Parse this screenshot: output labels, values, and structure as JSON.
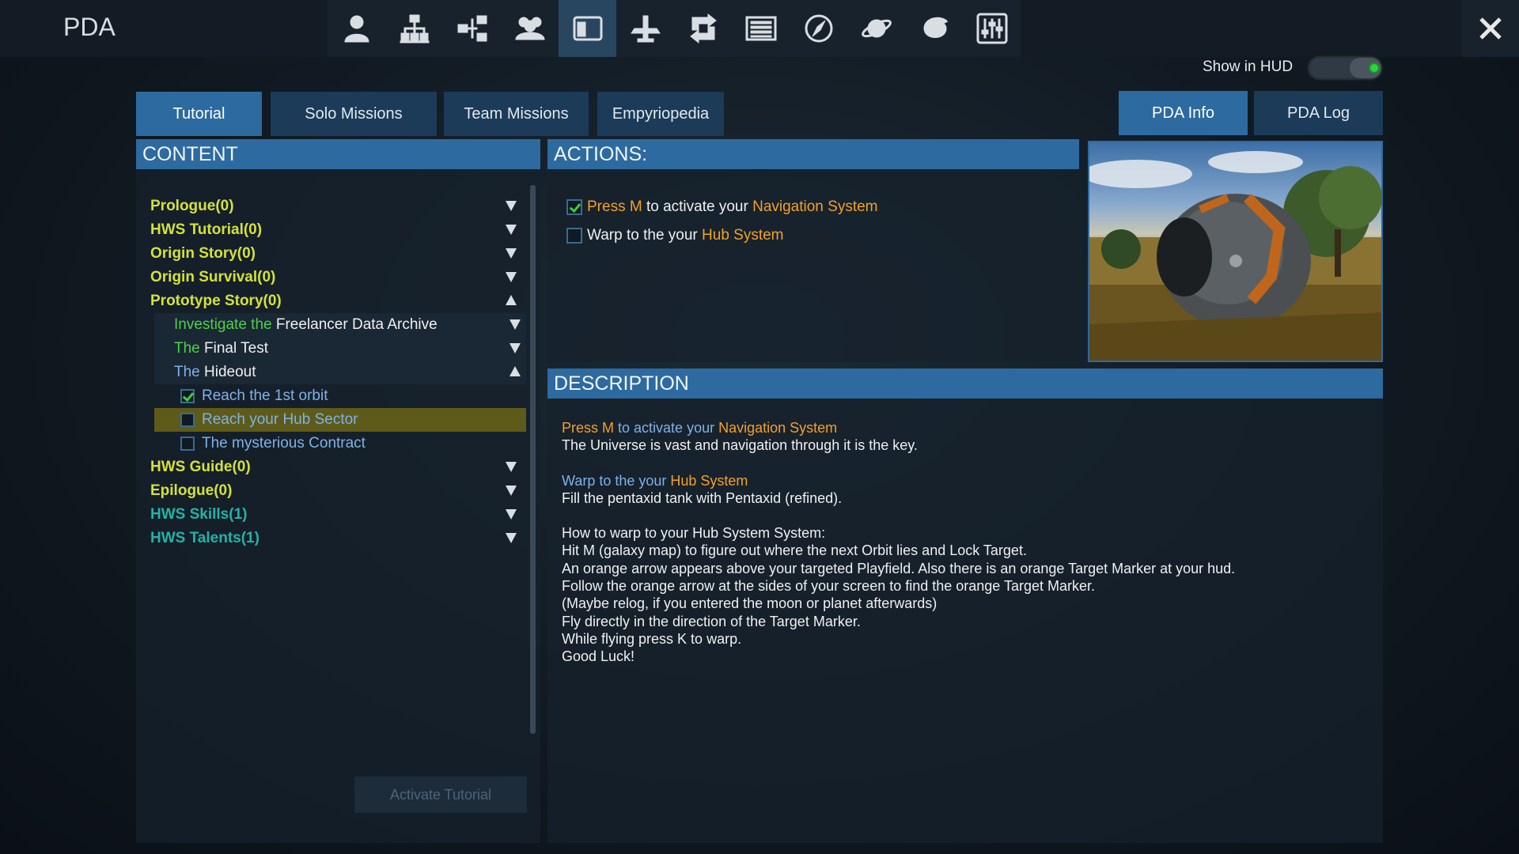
{
  "header": {
    "title": "PDA",
    "icons": [
      "player-icon",
      "network-icon",
      "structure-icon",
      "group-icon",
      "pda-window-icon",
      "ship-icon",
      "exchange-icon",
      "list-icon",
      "compass-icon",
      "planet-icon",
      "galaxy-icon",
      "settings-sliders-icon"
    ],
    "active_icon": 4
  },
  "hud": {
    "label": "Show in HUD",
    "enabled": true
  },
  "tabs": {
    "tutorial": "Tutorial",
    "solo": "Solo Missions",
    "team": "Team Missions",
    "empyriopedia": "Empyriopedia",
    "pda_info": "PDA Info",
    "pda_log": "PDA Log"
  },
  "content": {
    "header": "CONTENT",
    "items": {
      "prologue": "Prologue(0)",
      "hws_tutorial": "HWS Tutorial(0)",
      "origin_story": "Origin Story(0)",
      "origin_survival": "Origin Survival(0)",
      "prototype_story": "Prototype Story(0)",
      "investigate_pre": "Investigate the",
      "investigate_post": "Freelancer Data Archive",
      "final_pre": "The",
      "final_post": "Final Test",
      "hideout_pre": "The",
      "hideout_post": "Hideout",
      "task1": "Reach the 1st orbit",
      "task2": "Reach your Hub Sector",
      "task3": "The mysterious Contract",
      "hws_guide": "HWS Guide(0)",
      "epilogue": "Epilogue(0)",
      "hws_skills": "HWS Skills(1)",
      "hws_talents": "HWS Talents(1)"
    },
    "activate_button": "Activate Tutorial"
  },
  "actions": {
    "header": "ACTIONS:",
    "a1": {
      "p1": "Press M",
      "p2": " to activate your ",
      "p3": "Navigation System",
      "checked": true
    },
    "a2": {
      "p1": "Warp to the your ",
      "p2": "Hub System",
      "checked": false
    }
  },
  "description": {
    "header": "DESCRIPTION",
    "b1_p1": "Press M",
    "b1_p2": " to activate your ",
    "b1_p3": "Navigation System",
    "b1_line2": "The Universe is vast and navigation through it is the key.",
    "b2_p1": "Warp to the your ",
    "b2_p2": "Hub System",
    "b2_line2": "Fill the pentaxid tank with Pentaxid (refined).",
    "b3_lines": [
      "How to warp to your Hub System System:",
      "Hit M (galaxy map) to figure out where the next Orbit lies and Lock Target.",
      "An orange arrow appears above your targeted Playfield. Also there is an orange Target Marker at your hud.",
      "Follow the orange arrow at the sides of your screen to find the orange Target Marker.",
      "(Maybe relog, if you entered the moon or planet afterwards)",
      "Fly directly in the direction of the Target Marker.",
      "While flying press K to warp.",
      "Good Luck!"
    ]
  },
  "colors": {
    "accent": "#2d6aa0",
    "category_yellow": "#d5e13a",
    "category_teal": "#23b3a6",
    "highlight_orange": "#f3a126",
    "task_blue": "#7eb2e8",
    "green_text": "#4cd145"
  }
}
